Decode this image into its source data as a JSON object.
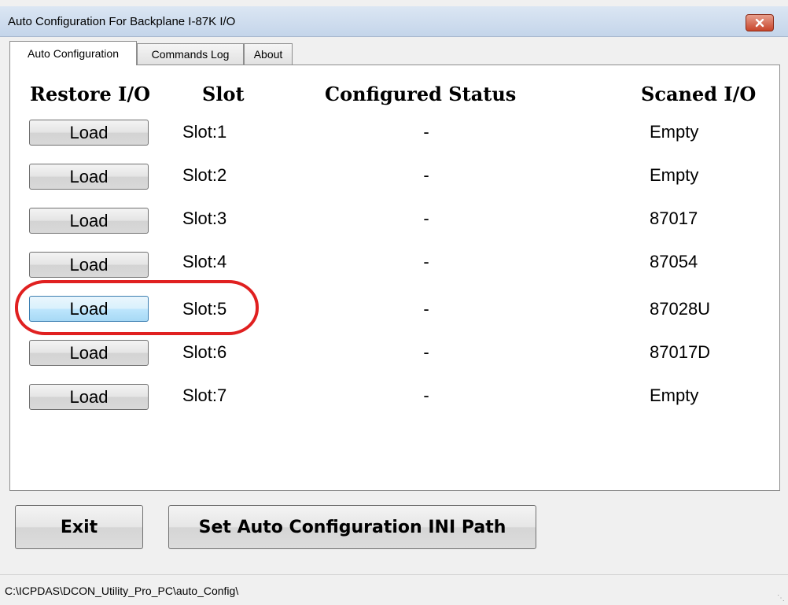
{
  "window": {
    "title": "Auto Configuration For Backplane I-87K I/O"
  },
  "tabs": [
    {
      "label": "Auto Configuration"
    },
    {
      "label": "Commands Log"
    },
    {
      "label": "About"
    }
  ],
  "table": {
    "headers": {
      "restore": "Restore I/O",
      "slot": "Slot",
      "status": "Configured Status",
      "scanned": "Scaned I/O"
    },
    "rows": [
      {
        "button": "Load",
        "slot": "Slot:1",
        "status": "-",
        "scanned": "Empty"
      },
      {
        "button": "Load",
        "slot": "Slot:2",
        "status": "-",
        "scanned": "Empty"
      },
      {
        "button": "Load",
        "slot": "Slot:3",
        "status": "-",
        "scanned": "87017"
      },
      {
        "button": "Load",
        "slot": "Slot:4",
        "status": "-",
        "scanned": "87054"
      },
      {
        "button": "Load",
        "slot": "Slot:5",
        "status": "-",
        "scanned": "87028U"
      },
      {
        "button": "Load",
        "slot": "Slot:6",
        "status": "-",
        "scanned": "87017D"
      },
      {
        "button": "Load",
        "slot": "Slot:7",
        "status": "-",
        "scanned": "Empty"
      }
    ]
  },
  "buttons": {
    "exit": "Exit",
    "set_ini_path": "Set Auto Configuration INI Path"
  },
  "statusbar": {
    "path": "C:\\ICPDAS\\DCON_Utility_Pro_PC\\auto_Config\\"
  },
  "annotation": {
    "highlight_color": "#e02020",
    "highlighted_row": 5
  },
  "icons": {
    "close": "close-icon",
    "grip": "resize-grip-icon"
  }
}
